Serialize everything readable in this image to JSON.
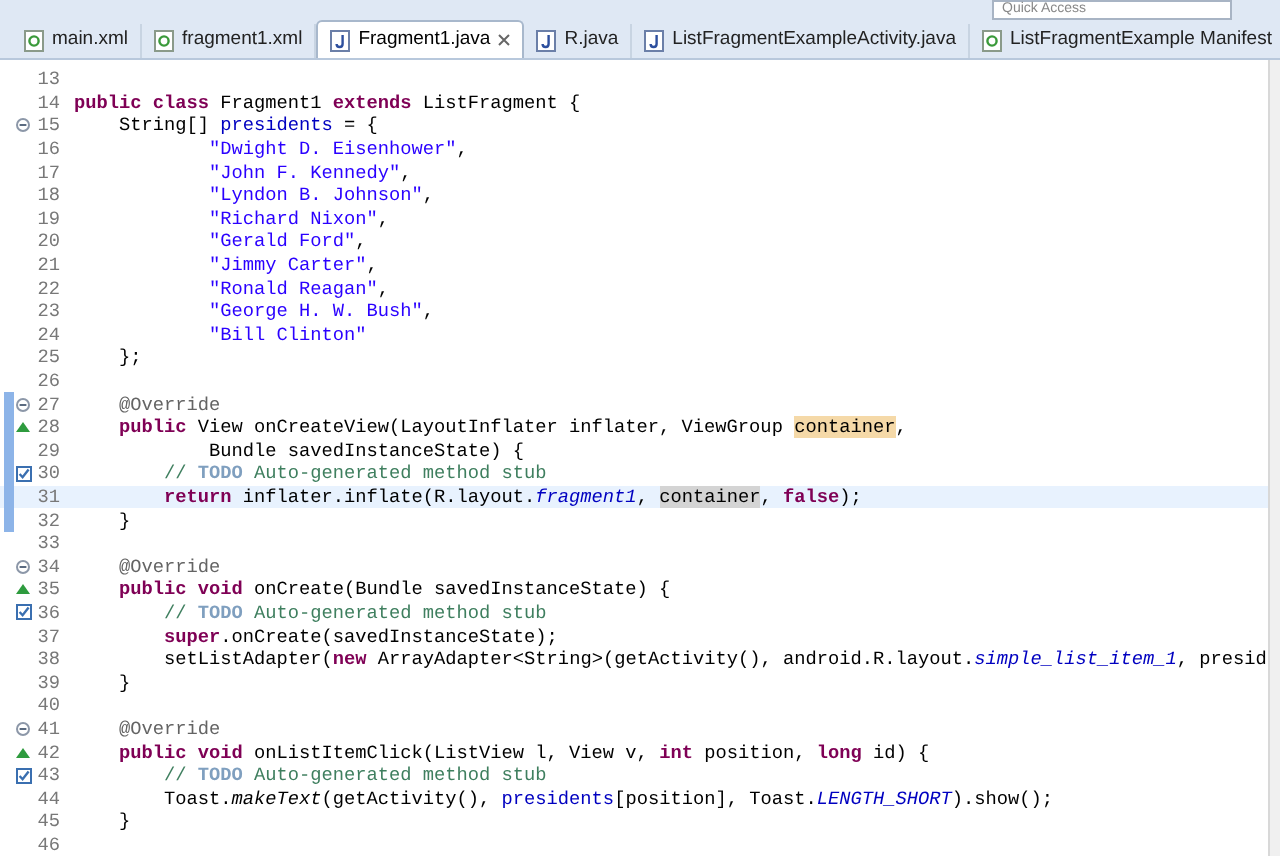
{
  "toolbar": {
    "quick_access": "Quick Access"
  },
  "tabs": [
    {
      "label": "main.xml",
      "kind": "xml",
      "selected": false
    },
    {
      "label": "fragment1.xml",
      "kind": "xml",
      "selected": false
    },
    {
      "label": "Fragment1.java",
      "kind": "java",
      "selected": true
    },
    {
      "label": "R.java",
      "kind": "java",
      "selected": false
    },
    {
      "label": "ListFragmentExampleActivity.java",
      "kind": "java",
      "selected": false
    },
    {
      "label": "ListFragmentExample Manifest",
      "kind": "manifest",
      "selected": false
    }
  ],
  "editor": {
    "lines": [
      {
        "number": "13",
        "kind": "plain",
        "in_range": false
      },
      {
        "number": "14",
        "kind": "plain",
        "in_range": false,
        "tokens": [
          {
            "kind": "kw",
            "text": "public class"
          },
          {
            "kind": "plain",
            "text": " Fragment1 "
          },
          {
            "kind": "kw",
            "text": "extends"
          },
          {
            "kind": "plain",
            "text": " ListFragment {"
          }
        ]
      },
      {
        "number": "15",
        "kind": "fold",
        "in_range": false,
        "tokens": [
          {
            "kind": "plain",
            "text": "    String[] "
          },
          {
            "kind": "field",
            "text": "presidents"
          },
          {
            "kind": "plain",
            "text": " = {"
          }
        ]
      },
      {
        "number": "16",
        "kind": "plain",
        "in_range": false,
        "tokens": [
          {
            "kind": "str",
            "text": "            \"Dwight D. Eisenhower\""
          },
          {
            "kind": "plain",
            "text": ","
          }
        ]
      },
      {
        "number": "17",
        "kind": "plain",
        "in_range": false,
        "tokens": [
          {
            "kind": "str",
            "text": "            \"John F. Kennedy\""
          },
          {
            "kind": "plain",
            "text": ","
          }
        ]
      },
      {
        "number": "18",
        "kind": "plain",
        "in_range": false,
        "tokens": [
          {
            "kind": "str",
            "text": "            \"Lyndon B. Johnson\""
          },
          {
            "kind": "plain",
            "text": ","
          }
        ]
      },
      {
        "number": "19",
        "kind": "plain",
        "in_range": false,
        "tokens": [
          {
            "kind": "str",
            "text": "            \"Richard Nixon\""
          },
          {
            "kind": "plain",
            "text": ","
          }
        ]
      },
      {
        "number": "20",
        "kind": "plain",
        "in_range": false,
        "tokens": [
          {
            "kind": "str",
            "text": "            \"Gerald Ford\""
          },
          {
            "kind": "plain",
            "text": ","
          }
        ]
      },
      {
        "number": "21",
        "kind": "plain",
        "in_range": false,
        "tokens": [
          {
            "kind": "str",
            "text": "            \"Jimmy Carter\""
          },
          {
            "kind": "plain",
            "text": ","
          }
        ]
      },
      {
        "number": "22",
        "kind": "plain",
        "in_range": false,
        "tokens": [
          {
            "kind": "str",
            "text": "            \"Ronald Reagan\""
          },
          {
            "kind": "plain",
            "text": ","
          }
        ]
      },
      {
        "number": "23",
        "kind": "plain",
        "in_range": false,
        "tokens": [
          {
            "kind": "str",
            "text": "            \"George H. W. Bush\""
          },
          {
            "kind": "plain",
            "text": ","
          }
        ]
      },
      {
        "number": "24",
        "kind": "plain",
        "in_range": false,
        "tokens": [
          {
            "kind": "str",
            "text": "            \"Bill Clinton\""
          }
        ]
      },
      {
        "number": "25",
        "kind": "plain",
        "in_range": false,
        "tokens": [
          {
            "kind": "plain",
            "text": "    };"
          }
        ]
      },
      {
        "number": "26",
        "kind": "plain",
        "in_range": false
      },
      {
        "number": "27",
        "kind": "fold",
        "in_range": true,
        "tokens": [
          {
            "kind": "ann",
            "text": "    @Override"
          }
        ]
      },
      {
        "number": "28",
        "kind": "override",
        "in_range": true,
        "tokens": [
          {
            "kind": "kw",
            "text": "    public"
          },
          {
            "kind": "plain",
            "text": " View onCreateView(LayoutInflater inflater, ViewGroup "
          },
          {
            "kind": "write-occurrence",
            "text": "container"
          },
          {
            "kind": "plain",
            "text": ","
          }
        ]
      },
      {
        "number": "29",
        "kind": "plain",
        "in_range": true,
        "tokens": [
          {
            "kind": "plain",
            "text": "            Bundle savedInstanceState) {"
          }
        ]
      },
      {
        "number": "30",
        "kind": "task",
        "in_range": true,
        "tokens": [
          {
            "kind": "comment",
            "text": "        // "
          },
          {
            "kind": "todo",
            "text": "TODO"
          },
          {
            "kind": "comment",
            "text": " Auto-generated method stub"
          }
        ]
      },
      {
        "number": "31",
        "kind": "plain",
        "in_range": true,
        "current": true,
        "tokens": [
          {
            "kind": "kw",
            "text": "        return"
          },
          {
            "kind": "plain",
            "text": " inflater.inflate(R.layout."
          },
          {
            "kind": "static",
            "text": "fragment1"
          },
          {
            "kind": "plain",
            "text": ", "
          },
          {
            "kind": "read-occurrence",
            "text": "container"
          },
          {
            "kind": "plain",
            "text": ", "
          },
          {
            "kind": "kw",
            "text": "false"
          },
          {
            "kind": "plain",
            "text": ");"
          }
        ]
      },
      {
        "number": "32",
        "kind": "plain",
        "in_range": true,
        "tokens": [
          {
            "kind": "plain",
            "text": "    }"
          }
        ]
      },
      {
        "number": "33",
        "kind": "plain",
        "in_range": false
      },
      {
        "number": "34",
        "kind": "fold",
        "in_range": false,
        "tokens": [
          {
            "kind": "ann",
            "text": "    @Override"
          }
        ]
      },
      {
        "number": "35",
        "kind": "override",
        "in_range": false,
        "tokens": [
          {
            "kind": "kw",
            "text": "    public void"
          },
          {
            "kind": "plain",
            "text": " onCreate(Bundle savedInstanceState) {"
          }
        ]
      },
      {
        "number": "36",
        "kind": "task",
        "in_range": false,
        "tokens": [
          {
            "kind": "comment",
            "text": "        // "
          },
          {
            "kind": "todo",
            "text": "TODO"
          },
          {
            "kind": "comment",
            "text": " Auto-generated method stub"
          }
        ]
      },
      {
        "number": "37",
        "kind": "plain",
        "in_range": false,
        "tokens": [
          {
            "kind": "kw",
            "text": "        super"
          },
          {
            "kind": "plain",
            "text": ".onCreate(savedInstanceState);"
          }
        ]
      },
      {
        "number": "38",
        "kind": "plain",
        "in_range": false,
        "tokens": [
          {
            "kind": "plain",
            "text": "        setListAdapter("
          },
          {
            "kind": "kw",
            "text": "new"
          },
          {
            "kind": "plain",
            "text": " ArrayAdapter<String>(getActivity(), android.R.layout."
          },
          {
            "kind": "static",
            "text": "simple_list_item_1"
          },
          {
            "kind": "plain",
            "text": ", presid"
          }
        ]
      },
      {
        "number": "39",
        "kind": "plain",
        "in_range": false,
        "tokens": [
          {
            "kind": "plain",
            "text": "    }"
          }
        ]
      },
      {
        "number": "40",
        "kind": "plain",
        "in_range": false
      },
      {
        "number": "41",
        "kind": "fold",
        "in_range": false,
        "tokens": [
          {
            "kind": "ann",
            "text": "    @Override"
          }
        ]
      },
      {
        "number": "42",
        "kind": "override",
        "in_range": false,
        "tokens": [
          {
            "kind": "kw",
            "text": "    public void"
          },
          {
            "kind": "plain",
            "text": " onListItemClick(ListView l, View v, "
          },
          {
            "kind": "kw",
            "text": "int"
          },
          {
            "kind": "plain",
            "text": " position, "
          },
          {
            "kind": "kw",
            "text": "long"
          },
          {
            "kind": "plain",
            "text": " id) {"
          }
        ]
      },
      {
        "number": "43",
        "kind": "task",
        "in_range": false,
        "tokens": [
          {
            "kind": "comment",
            "text": "        // "
          },
          {
            "kind": "todo",
            "text": "TODO"
          },
          {
            "kind": "comment",
            "text": " Auto-generated method stub"
          }
        ]
      },
      {
        "number": "44",
        "kind": "plain",
        "in_range": false,
        "tokens": [
          {
            "kind": "plain",
            "text": "        Toast."
          },
          {
            "kind": "static-method",
            "text": "makeText"
          },
          {
            "kind": "plain",
            "text": "(getActivity(), "
          },
          {
            "kind": "field",
            "text": "presidents"
          },
          {
            "kind": "plain",
            "text": "[position], Toast."
          },
          {
            "kind": "static",
            "text": "LENGTH_SHORT"
          },
          {
            "kind": "plain",
            "text": ").show();"
          }
        ]
      },
      {
        "number": "45",
        "kind": "plain",
        "in_range": false,
        "tokens": [
          {
            "kind": "plain",
            "text": "    }"
          }
        ]
      },
      {
        "number": "46",
        "kind": "plain",
        "in_range": false
      }
    ]
  }
}
